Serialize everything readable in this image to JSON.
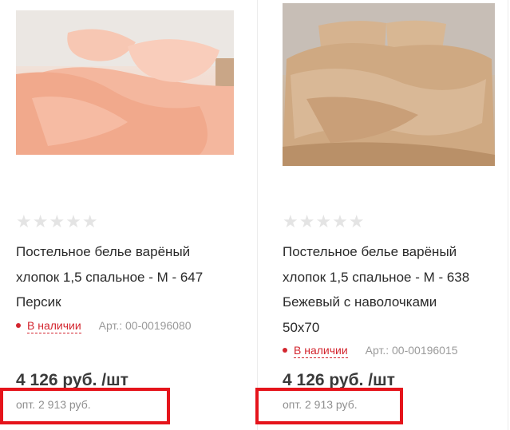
{
  "products": [
    {
      "image": "peach-bedding-photo",
      "rating_stars": 5,
      "title_lines": [
        "Постельное белье варёный",
        "хлопок 1,5 спальное - М - 647",
        "Персик"
      ],
      "stock": "В наличии",
      "sku": "Арт.: 00-00196080",
      "price": "4 126 руб. /шт",
      "wholesale": "опт. 2 913 руб."
    },
    {
      "image": "beige-bedding-photo",
      "rating_stars": 5,
      "title_lines": [
        "Постельное белье варёный",
        "хлопок 1,5 спальное - М - 638",
        "Бежевый с наволочками",
        "50х70"
      ],
      "stock": "В наличии",
      "sku": "Арт.: 00-00196015",
      "price": "4 126 руб. /шт",
      "wholesale": "опт. 2 913 руб."
    }
  ],
  "stars_glyphs": "★★★★★",
  "colors": {
    "stock_red": "#d3262f",
    "highlight_red": "#e5141b",
    "star_empty": "#e4e4e4"
  }
}
